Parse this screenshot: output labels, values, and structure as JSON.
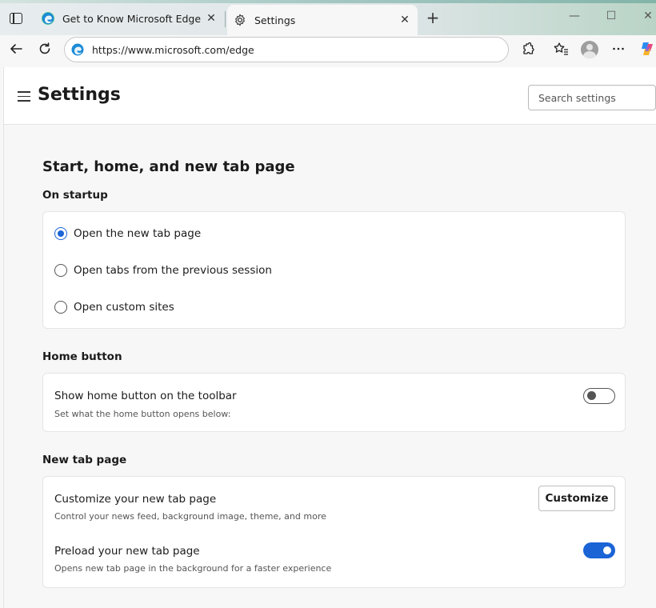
{
  "browser": {
    "tabs": [
      {
        "label": "Get to Know Microsoft Edge",
        "close": "✕"
      },
      {
        "label": "Settings",
        "close": "✕"
      }
    ],
    "new_tab": "+",
    "window_controls": {
      "minimize": "—",
      "maximize": "☐",
      "close": "✕"
    },
    "address": {
      "url": "https://www.microsoft.com/edge"
    },
    "icons": [
      "window-icon",
      "edge-icon",
      "gear-icon",
      "back-icon",
      "refresh-icon",
      "extensions-icon",
      "favorites-icon",
      "profile-icon",
      "more-icon",
      "copilot-icon"
    ]
  },
  "settings": {
    "title": "Settings",
    "search_placeholder": "Search settings",
    "section_title": "Start, home, and new tab page",
    "startup": {
      "title": "On startup",
      "options": [
        {
          "label": "Open the new tab page",
          "checked": true
        },
        {
          "label": "Open tabs from the previous session",
          "checked": false
        },
        {
          "label": "Open custom sites",
          "checked": false
        }
      ]
    },
    "home_button": {
      "title": "Home button",
      "label": "Show home button on the toolbar",
      "sub": "Set what the home button opens below:",
      "enabled": false
    },
    "new_tab_page": {
      "title": "New tab page",
      "customize_label": "Customize your new tab page",
      "customize_sub": "Control your news feed, background image, theme, and more",
      "customize_button": "Customize",
      "preload_label": "Preload your new tab page",
      "preload_sub": "Opens new tab page in the background for a faster experience",
      "preload_enabled": true
    }
  },
  "colors": {
    "accent": "#1a64d6",
    "surface": "#ffffff",
    "background": "#f7f7f7"
  }
}
